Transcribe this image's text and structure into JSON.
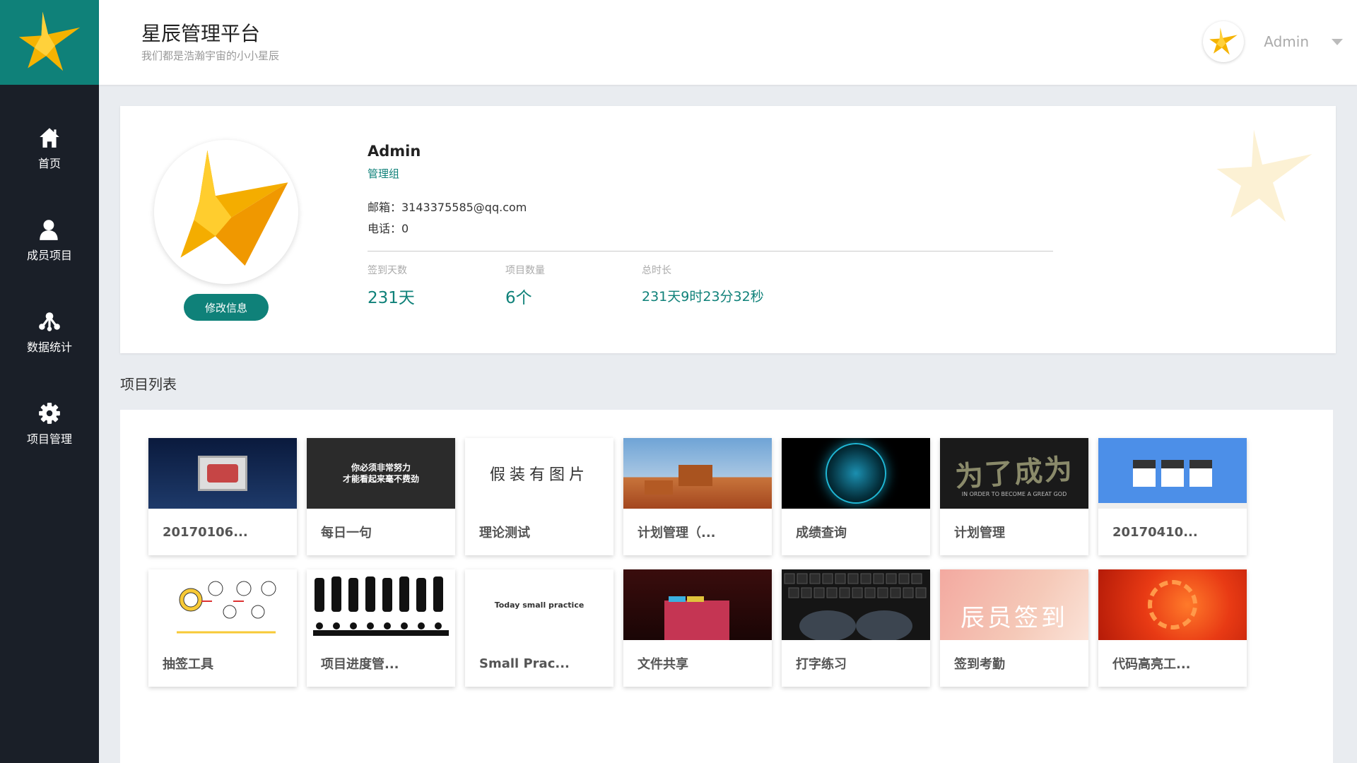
{
  "app": {
    "title": "星辰管理平台",
    "subtitle": "我们都是浩瀚宇宙的小小星辰",
    "accent": "#0f8179",
    "sidebar_bg": "#1a1f28"
  },
  "sidebar": {
    "items": [
      {
        "label": "首页",
        "icon": "home-icon"
      },
      {
        "label": "成员项目",
        "icon": "user-icon"
      },
      {
        "label": "数据统计",
        "icon": "network-icon"
      },
      {
        "label": "项目管理",
        "icon": "gear-icon"
      }
    ]
  },
  "header": {
    "user_name": "Admin"
  },
  "profile": {
    "name": "Admin",
    "group": "管理组",
    "email_line": "邮箱：3143375585@qq.com",
    "phone_line": "电话：0",
    "edit_label": "修改信息",
    "stats": [
      {
        "label": "签到天数",
        "value": "231天"
      },
      {
        "label": "项目数量",
        "value": "6个"
      },
      {
        "label": "总时长",
        "value": "231天9时23分32秒"
      }
    ]
  },
  "projects": {
    "title": "项目列表",
    "thumb_texts": {
      "quote_line1": "你必须非常努力",
      "quote_line2": "才能看起来毫不费劲",
      "fake_pic": "假装有图片",
      "practice": "Today small practice",
      "chengwei": "为了成为",
      "chengwei_sub": "IN ORDER TO BECOME A GREAT GOD",
      "qiandao": "辰员签到"
    },
    "items": [
      {
        "label": "20170106...",
        "thumb": "night-slide"
      },
      {
        "label": "每日一句",
        "thumb": "quote"
      },
      {
        "label": "理论测试",
        "thumb": "fake-pic"
      },
      {
        "label": "计划管理（...",
        "thumb": "desert"
      },
      {
        "label": "成绩查询",
        "thumb": "globe"
      },
      {
        "label": "计划管理",
        "thumb": "become"
      },
      {
        "label": "20170410...",
        "thumb": "blue-site"
      },
      {
        "label": "抽签工具",
        "thumb": "sketch"
      },
      {
        "label": "项目进度管...",
        "thumb": "silhouettes"
      },
      {
        "label": "Small Prac...",
        "thumb": "practice"
      },
      {
        "label": "文件共享",
        "thumb": "folder"
      },
      {
        "label": "打字练习",
        "thumb": "keyboard"
      },
      {
        "label": "签到考勤",
        "thumb": "signin"
      },
      {
        "label": "代码高亮工...",
        "thumb": "flower"
      }
    ]
  }
}
